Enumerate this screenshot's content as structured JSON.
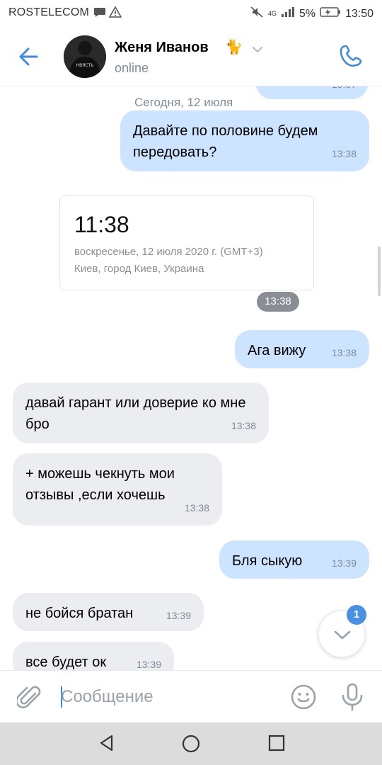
{
  "status_bar": {
    "carrier": "ROSTELECOM",
    "network": "4G",
    "battery": "5%",
    "time": "13:50"
  },
  "header": {
    "contact_name": "Женя Иванов",
    "name_emoji": "🐈",
    "status": "online",
    "avatar_shirt_text": "НВЯСТЬ"
  },
  "chat": {
    "partial_top_time": "13:37",
    "date_separator": "Сегодня, 12 июля",
    "messages": [
      {
        "dir": "out",
        "text": "Давайте по половине будем передовать?",
        "time": "13:38"
      },
      {
        "dir": "out",
        "text": "Ага вижу",
        "time": "13:38"
      },
      {
        "dir": "in",
        "text": "давай гарант или доверие ко мне бро",
        "time": "13:38"
      },
      {
        "dir": "in",
        "text": "+ можешь чекнуть мои отзывы ,если хочешь",
        "time": "13:38"
      },
      {
        "dir": "out",
        "text": "Бля сыкую",
        "time": "13:39"
      },
      {
        "dir": "in",
        "text": "не бойся братан",
        "time": "13:39"
      },
      {
        "dir": "in",
        "text": "все будет ок",
        "time": "13:39"
      }
    ],
    "screenshot_card": {
      "time": "11:38",
      "line1": "воскресенье, 12 июля 2020 г. (GMT+3)",
      "line2": "Киев, город Киев, Украина",
      "sent_time": "13:38"
    },
    "unread_badge": "1"
  },
  "input": {
    "placeholder": "Сообщение"
  },
  "colors": {
    "accent": "#3f8ae0",
    "outgoing_bubble": "#cce4ff",
    "incoming_bubble": "#ebedf0",
    "secondary_text": "#818c99"
  }
}
